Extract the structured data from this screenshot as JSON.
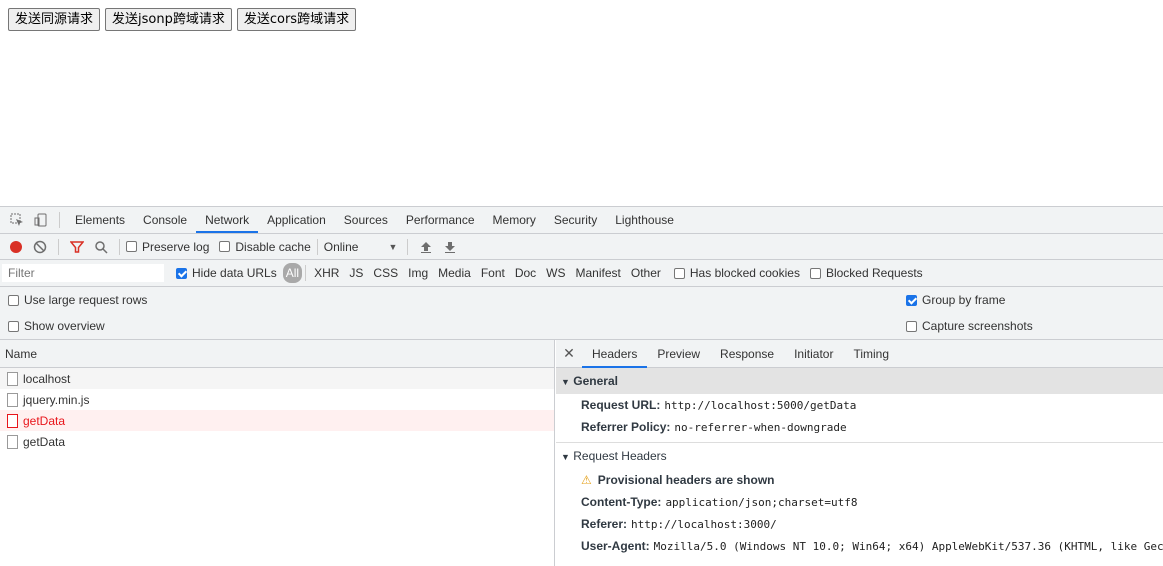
{
  "page": {
    "buttons": [
      "发送同源请求",
      "发送jsonp跨域请求",
      "发送cors跨域请求"
    ]
  },
  "devtools": {
    "tabs": [
      "Elements",
      "Console",
      "Network",
      "Application",
      "Sources",
      "Performance",
      "Memory",
      "Security",
      "Lighthouse"
    ],
    "active_tab": "Network",
    "toolbar": {
      "preserve_log": "Preserve log",
      "disable_cache": "Disable cache",
      "throttle": "Online"
    },
    "filter": {
      "placeholder": "Filter",
      "hide_data_urls": "Hide data URLs",
      "types": [
        "All",
        "XHR",
        "JS",
        "CSS",
        "Img",
        "Media",
        "Font",
        "Doc",
        "WS",
        "Manifest",
        "Other"
      ],
      "has_blocked_cookies": "Has blocked cookies",
      "blocked_requests": "Blocked Requests"
    },
    "options": {
      "large_rows": "Use large request rows",
      "group_by_frame": "Group by frame",
      "show_overview": "Show overview",
      "capture_screenshots": "Capture screenshots"
    },
    "list": {
      "header": "Name",
      "requests": [
        "localhost",
        "jquery.min.js",
        "getData",
        "getData"
      ]
    },
    "detail": {
      "tabs": [
        "Headers",
        "Preview",
        "Response",
        "Initiator",
        "Timing"
      ],
      "general": {
        "title": "General",
        "request_url_key": "Request URL:",
        "request_url_val": "http://localhost:5000/getData",
        "referrer_policy_key": "Referrer Policy:",
        "referrer_policy_val": "no-referrer-when-downgrade"
      },
      "request_headers": {
        "title": "Request Headers",
        "warning": "Provisional headers are shown",
        "content_type_key": "Content-Type:",
        "content_type_val": "application/json;charset=utf8",
        "referer_key": "Referer:",
        "referer_val": "http://localhost:3000/",
        "ua_key": "User-Agent:",
        "ua_val": "Mozilla/5.0 (Windows NT 10.0; Win64; x64) AppleWebKit/537.36 (KHTML, like Gec"
      }
    }
  }
}
